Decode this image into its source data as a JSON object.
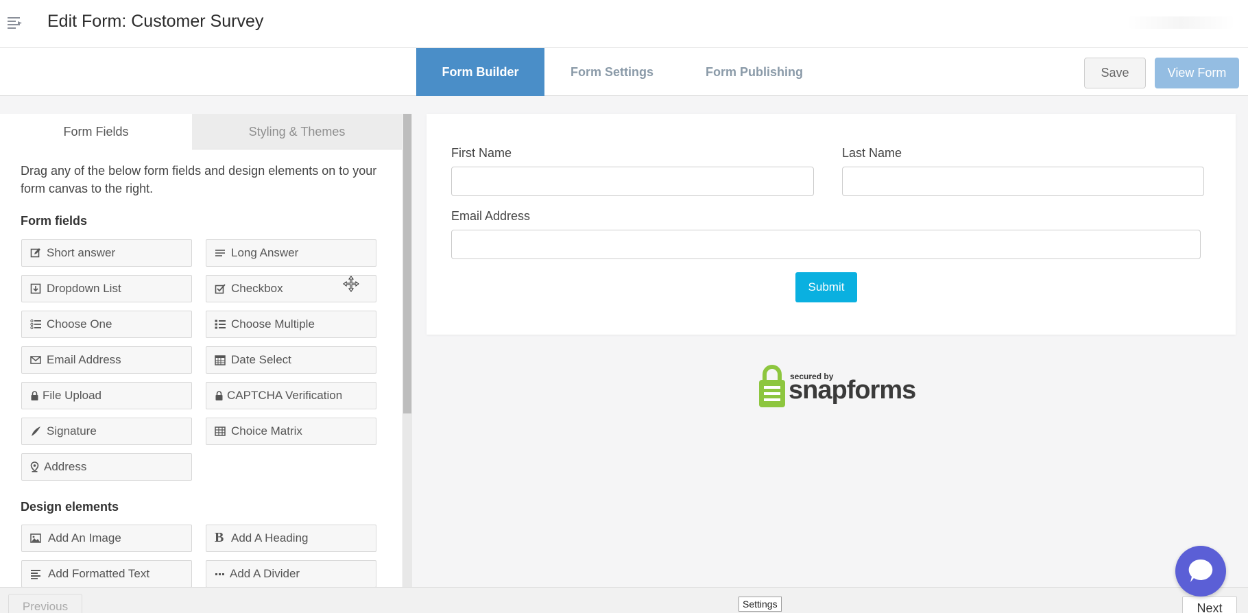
{
  "header": {
    "title": "Edit Form: Customer Survey"
  },
  "tabs": [
    {
      "label": "Form Builder",
      "active": true
    },
    {
      "label": "Form Settings",
      "active": false
    },
    {
      "label": "Form Publishing",
      "active": false
    }
  ],
  "actions": {
    "save_label": "Save",
    "view_label": "View Form"
  },
  "left_panel": {
    "tabs": [
      {
        "label": "Form Fields",
        "active": true
      },
      {
        "label": "Styling & Themes",
        "active": false
      }
    ],
    "description": "Drag any of the below form fields and design elements on to your form canvas to the right.",
    "form_fields_heading": "Form fields",
    "form_fields": [
      {
        "label": "Short answer",
        "icon": "edit-icon"
      },
      {
        "label": "Long Answer",
        "icon": "text-lines-icon"
      },
      {
        "label": "Dropdown List",
        "icon": "dropdown-icon"
      },
      {
        "label": "Checkbox",
        "icon": "checkbox-icon"
      },
      {
        "label": "Choose One",
        "icon": "radio-list-icon"
      },
      {
        "label": "Choose Multiple",
        "icon": "bullet-list-icon"
      },
      {
        "label": "Email Address",
        "icon": "envelope-icon"
      },
      {
        "label": "Date Select",
        "icon": "calendar-icon"
      },
      {
        "label": "File Upload",
        "icon": "lock-icon"
      },
      {
        "label": "CAPTCHA Verification",
        "icon": "lock-icon"
      },
      {
        "label": "Signature",
        "icon": "pen-icon"
      },
      {
        "label": "Choice Matrix",
        "icon": "table-icon"
      },
      {
        "label": "Address",
        "icon": "map-pin-icon"
      }
    ],
    "design_heading": "Design elements",
    "design_elements": [
      {
        "label": "Add An Image",
        "icon": "image-icon"
      },
      {
        "label": "Add A Heading",
        "icon": "bold-icon"
      },
      {
        "label": "Add Formatted Text",
        "icon": "align-left-icon"
      },
      {
        "label": "Add A Divider",
        "icon": "ellipsis-icon"
      }
    ]
  },
  "form_canvas": {
    "first_name_label": "First Name",
    "last_name_label": "Last Name",
    "email_label": "Email Address",
    "submit_label": "Submit"
  },
  "badge": {
    "secured_by": "secured by",
    "brand": "snapforms",
    "brand_color": "#8dc63f"
  },
  "footer": {
    "previous_label": "Previous",
    "next_label": "Next",
    "tooltip": "Settings"
  },
  "colors": {
    "active_tab": "#4a8ec8",
    "view_button": "#94bde2",
    "submit": "#0ab0e0",
    "chat": "#5b5fd6"
  }
}
